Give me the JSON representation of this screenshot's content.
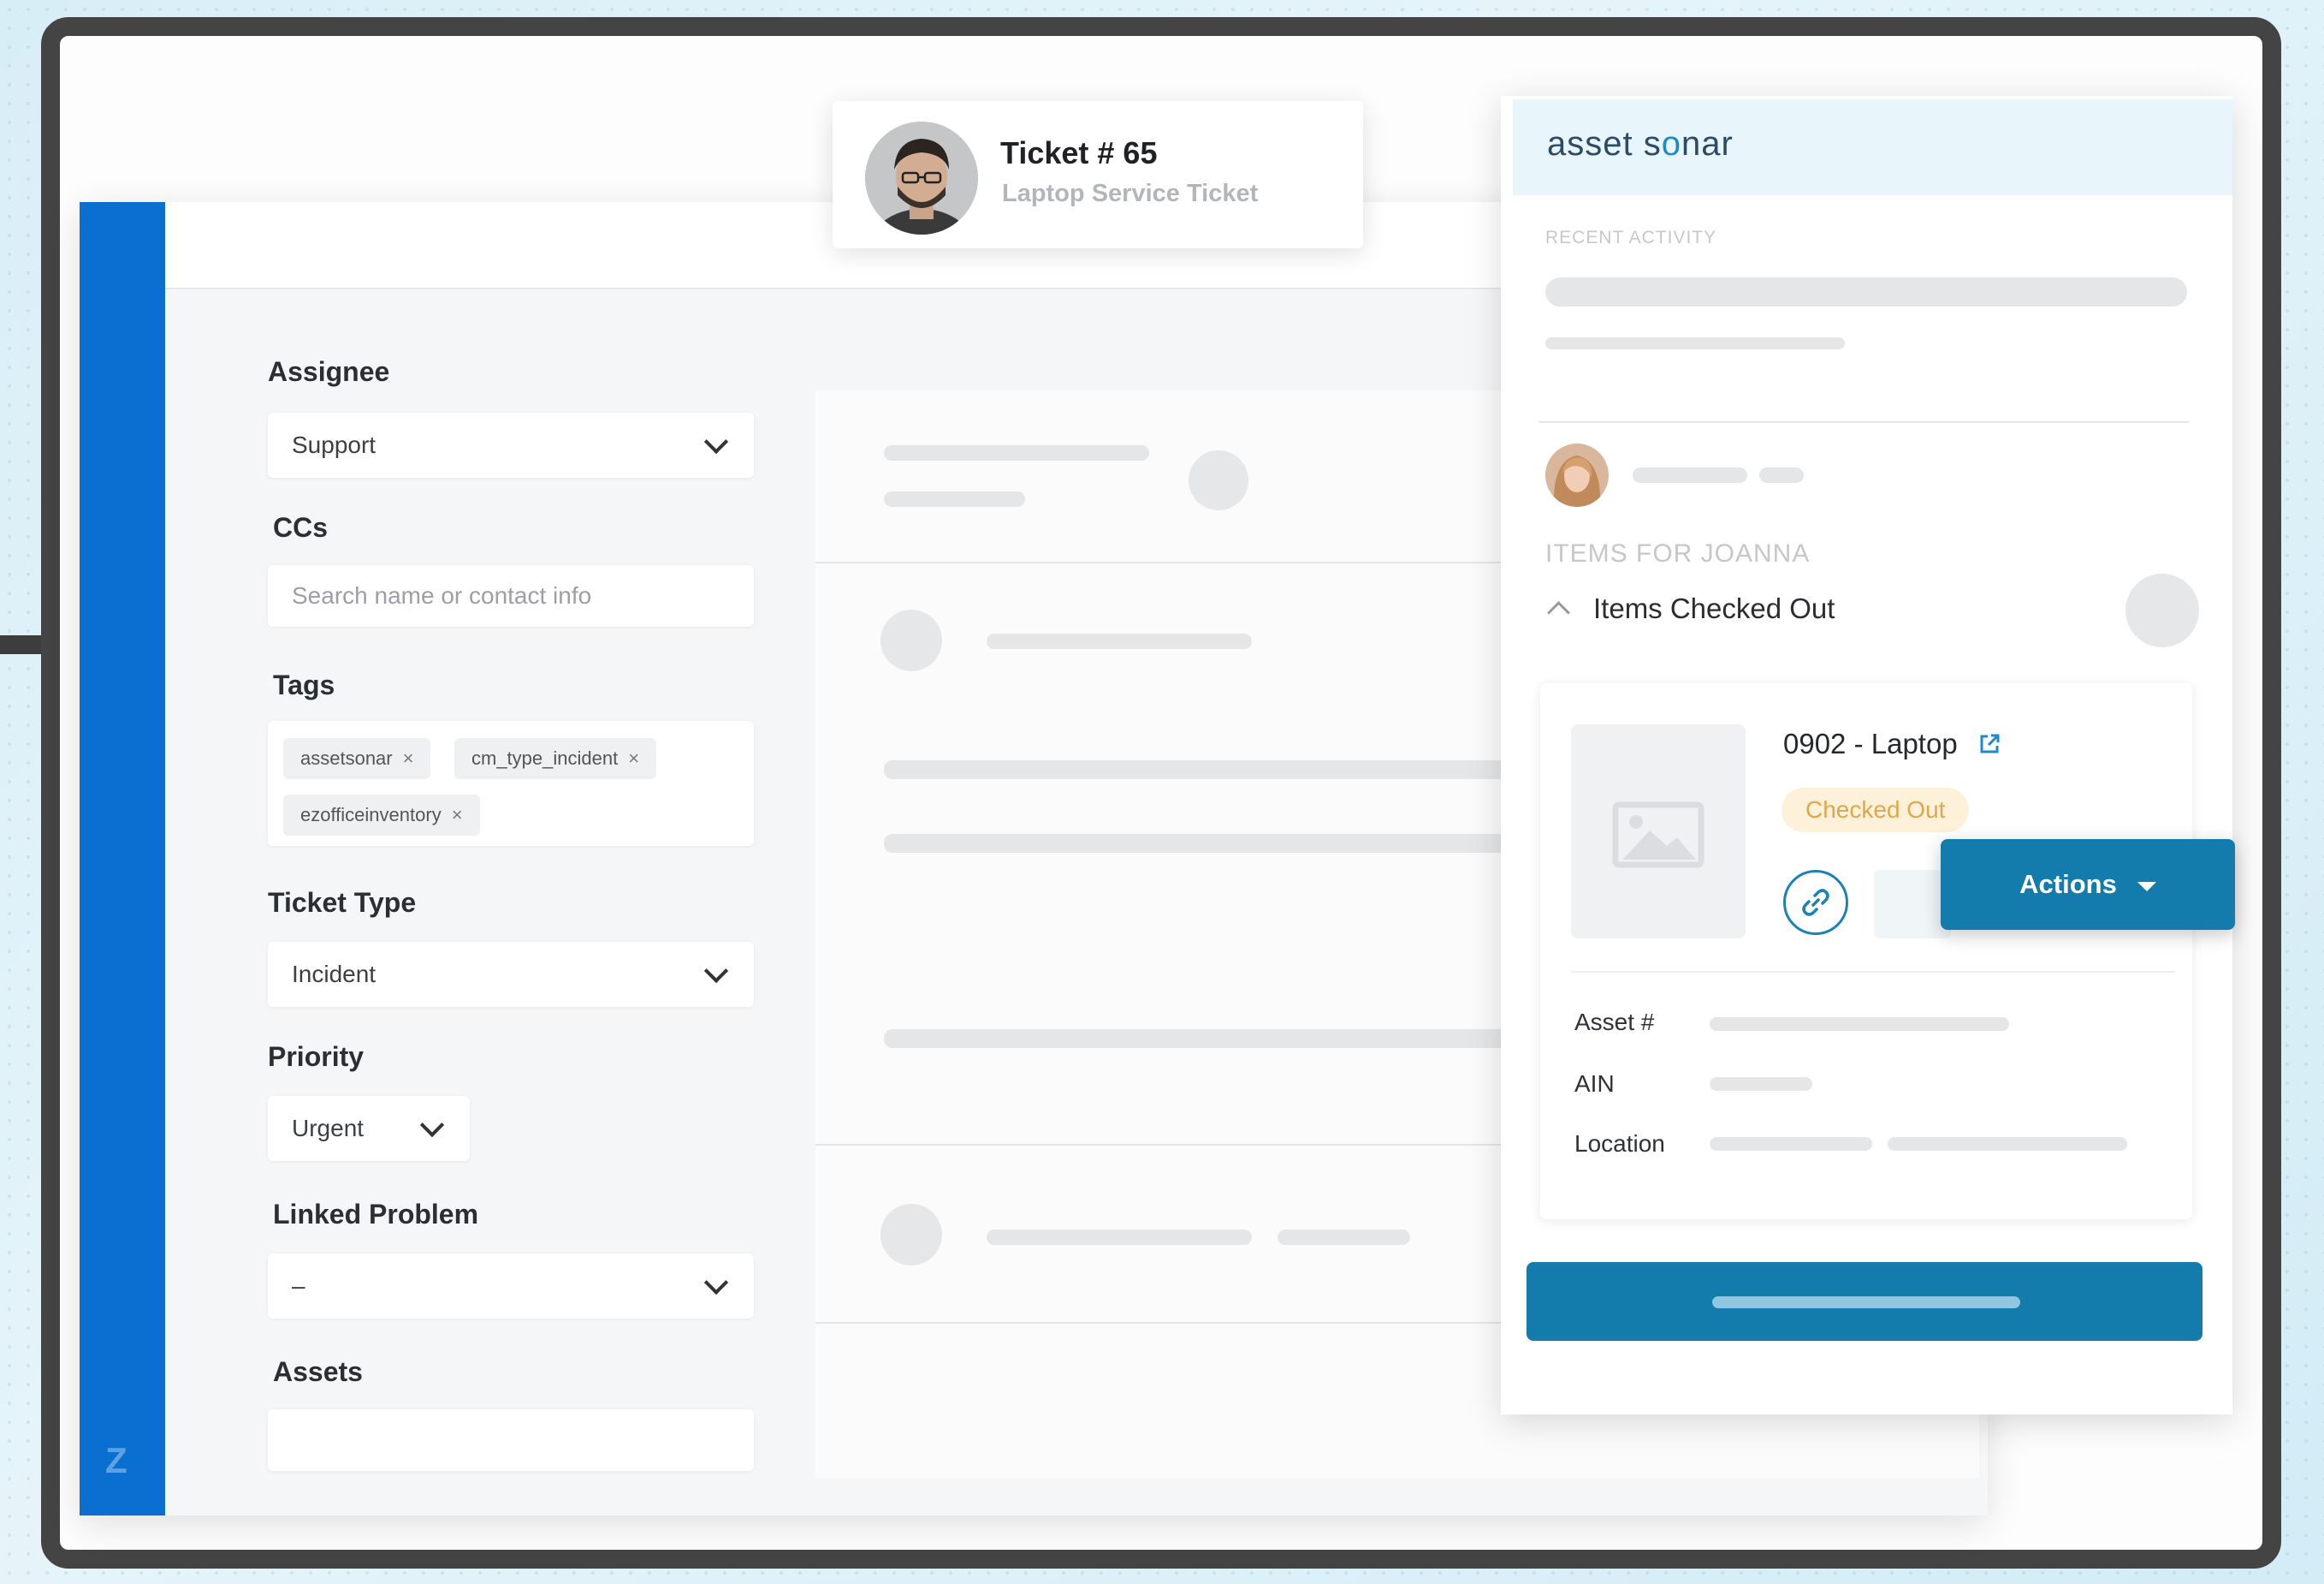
{
  "ticket": {
    "title": "Ticket # 65",
    "subtitle": "Laptop Service Ticket"
  },
  "zendesk": {
    "assignee": {
      "label": "Assignee",
      "value": "Support"
    },
    "ccs": {
      "label": "CCs",
      "placeholder": "Search name or contact info"
    },
    "tags": {
      "label": "Tags",
      "items": [
        "assetsonar",
        "cm_type_incident",
        "ezofficeinventory"
      ],
      "remove_glyph": "×"
    },
    "ticket_type": {
      "label": "Ticket Type",
      "value": "Incident"
    },
    "priority": {
      "label": "Priority",
      "value": "Urgent"
    },
    "linked_problem": {
      "label": "Linked Problem",
      "value": "–"
    },
    "assets": {
      "label": "Assets"
    },
    "logo_icon": "zendesk-logo-icon"
  },
  "assetsonar": {
    "logo_text_a": "asset s",
    "logo_text_o": "o",
    "logo_text_b": "nar",
    "recent_activity": "RECENT ACTIVITY",
    "items_for": "ITEMS FOR JOANNA",
    "section_title": "Items Checked Out",
    "item": {
      "name": "0902 - Laptop",
      "status": "Checked Out",
      "status_color": "#e2a64a"
    },
    "props": {
      "asset_no": "Asset #",
      "ain": "AIN",
      "location": "Location"
    },
    "actions_label": "Actions",
    "accent": "#137cad"
  }
}
